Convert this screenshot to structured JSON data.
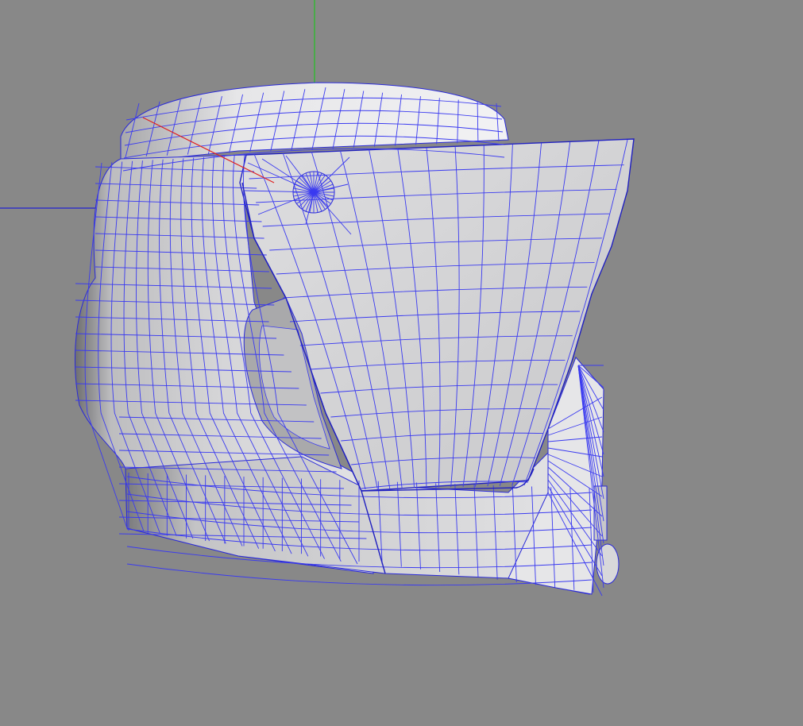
{
  "viewport": {
    "background_color": "#888888",
    "wireframe_color": "#3a3af0",
    "mesh_fill_light": "#e8e8ea",
    "mesh_fill_mid": "#cfcfd1",
    "mesh_fill_dark": "#8a8a8c",
    "axis_colors": {
      "x": "#e02020",
      "y": "#20c020",
      "z": "#2020d0"
    }
  },
  "model": {
    "object_icon": "helmet-mesh",
    "render_mode": "shaded-wireframe"
  }
}
